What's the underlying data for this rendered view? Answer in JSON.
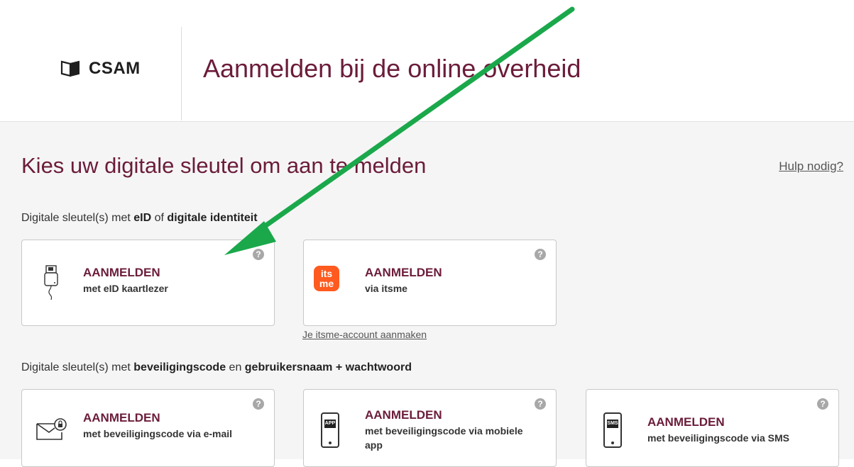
{
  "header": {
    "logo_text": "CSAM",
    "title": "Aanmelden bij de online overheid"
  },
  "main": {
    "title": "Kies uw digitale sleutel om aan te melden",
    "help_link": "Hulp nodig?",
    "section1": {
      "prefix": "Digitale sleutel(s) met ",
      "b1": "eID",
      "mid": " of ",
      "b2": "digitale identiteit"
    },
    "section2": {
      "prefix": "Digitale sleutel(s) met ",
      "b1": "beveiligingscode",
      "mid": " en ",
      "b2": "gebruikersnaam + wachtwoord"
    },
    "cards": [
      {
        "title": "AANMELDEN",
        "sub": "met eID kaartlezer",
        "icon": "card-reader-icon"
      },
      {
        "title": "AANMELDEN",
        "sub": "via itsme",
        "icon": "itsme-icon",
        "icon_text_1": "its",
        "icon_text_2": "me"
      },
      {
        "title": "AANMELDEN",
        "sub": "met beveiligingscode via e-mail",
        "icon": "envelope-icon"
      },
      {
        "title": "AANMELDEN",
        "sub": "met beveiligingscode via mobiele app",
        "icon": "mobile-app-icon",
        "icon_text": "APP"
      },
      {
        "title": "AANMELDEN",
        "sub": "met beveiligingscode via SMS",
        "icon": "sms-phone-icon",
        "icon_text": "SMS"
      }
    ],
    "help_icon_glyph": "?",
    "itsme_create_link": "Je itsme-account aanmaken"
  },
  "colors": {
    "brand": "#6b1c3a",
    "arrow": "#1aa84b",
    "itsme": "#ff5a1f"
  }
}
